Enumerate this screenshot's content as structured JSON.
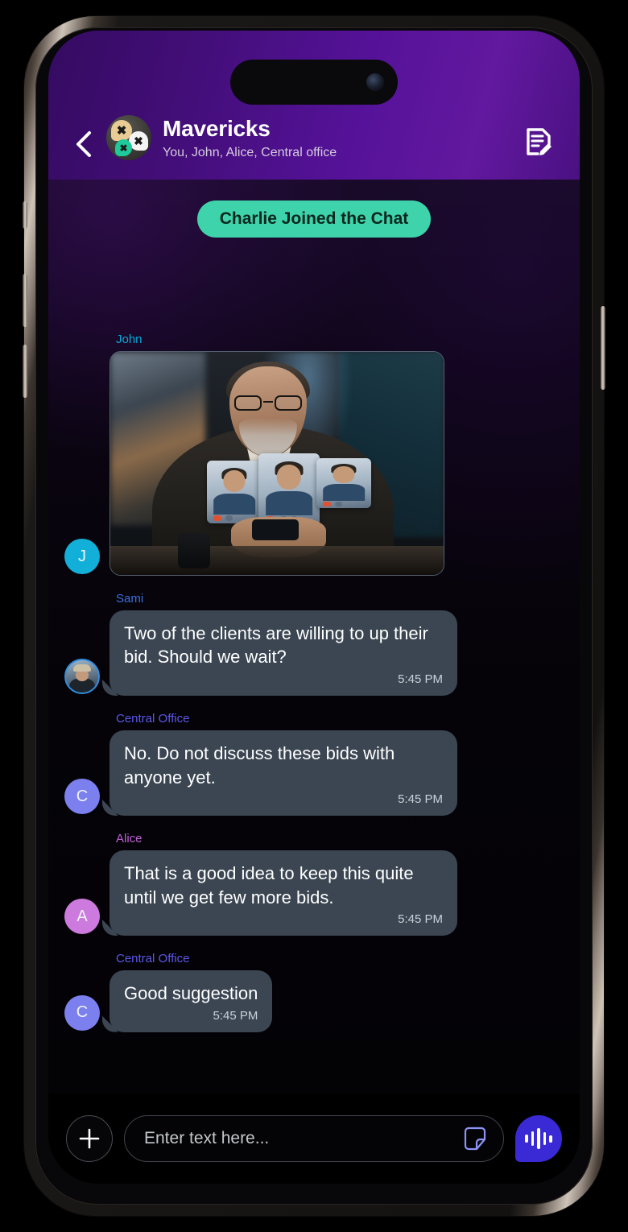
{
  "header": {
    "back_icon": "chevron-left-icon",
    "avatar_icon": "group-avatar-speech-bubbles",
    "title": "Mavericks",
    "subtitle": "You, John, Alice, Central office",
    "action_icon": "note-edit-icon",
    "gradient_from": "#350b61",
    "gradient_to": "#62189f"
  },
  "system_notice": {
    "text": "Charlie Joined the Chat",
    "background": "#3ed3aa",
    "text_color": "#09251c"
  },
  "messages": [
    {
      "sender": "John",
      "sender_color": "#0aa6d6",
      "avatar_type": "initial",
      "avatar_initial": "J",
      "avatar_color": "#12b0d8",
      "type": "image",
      "image_alt": "Businessman on a video call with three participant tiles",
      "text": "",
      "time": ""
    },
    {
      "sender": "Sami",
      "sender_color": "#3a6fe0",
      "avatar_type": "photo",
      "avatar_initial": "",
      "avatar_color": "#2f8fe0",
      "type": "text",
      "text": "Two of the clients are willing to up their bid. Should we wait?",
      "time": "5:45 PM"
    },
    {
      "sender": "Central Office",
      "sender_color": "#5b57ea",
      "avatar_type": "initial",
      "avatar_initial": "C",
      "avatar_color": "#7b80ee",
      "type": "text",
      "text": "No. Do not discuss these bids with anyone yet.",
      "time": "5:45 PM"
    },
    {
      "sender": "Alice",
      "sender_color": "#c060d8",
      "avatar_type": "initial",
      "avatar_initial": "A",
      "avatar_color": "#cc7ade",
      "type": "text",
      "text": "That is a good idea to keep this quite until we get few more bids.",
      "time": "5:45 PM"
    },
    {
      "sender": "Central Office",
      "sender_color": "#5b57ea",
      "avatar_type": "initial",
      "avatar_initial": "C",
      "avatar_color": "#7b80ee",
      "type": "text",
      "text": "Good suggestion",
      "time": "5:45 PM"
    }
  ],
  "input_bar": {
    "add_icon": "plus-icon",
    "placeholder": "Enter text here...",
    "value": "",
    "sticker_icon": "sticker-icon",
    "voice_icon": "voice-waveform-bubble-icon",
    "voice_color": "#3a2ad6"
  },
  "bubble_style": {
    "background": "#3b4652",
    "text_color": "#ffffff",
    "time_color": "#c9d2da"
  }
}
